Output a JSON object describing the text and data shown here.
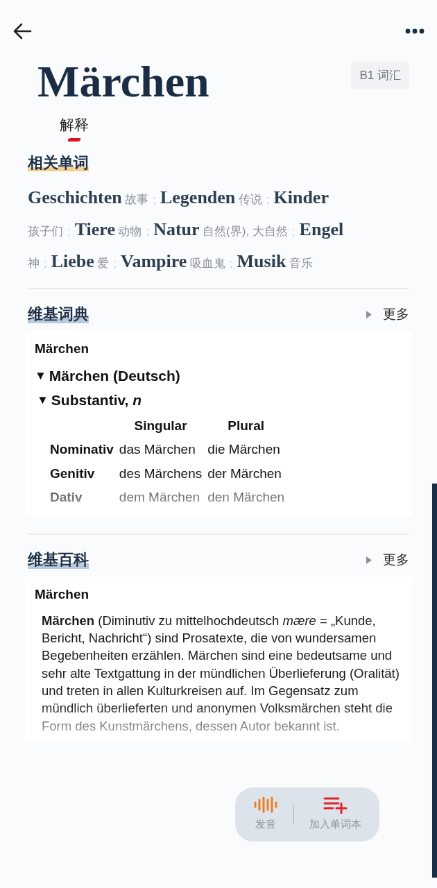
{
  "headword": {
    "text": "Märchen",
    "level_badge": "B1 词汇"
  },
  "tabs": [
    {
      "label": "解释",
      "selected": true
    }
  ],
  "related": {
    "title": "相关单词",
    "separator": ";",
    "items": [
      {
        "word": "Geschichten",
        "meaning": "故事"
      },
      {
        "word": "Legenden",
        "meaning": "传说"
      },
      {
        "word": "Kinder",
        "meaning": "孩子们"
      },
      {
        "word": "Tiere",
        "meaning": "动物"
      },
      {
        "word": "Natur",
        "meaning": "自然(界), 大自然"
      },
      {
        "word": "Engel",
        "meaning": "神"
      },
      {
        "word": "Liebe",
        "meaning": "爱"
      },
      {
        "word": "Vampire",
        "meaning": "吸血鬼"
      },
      {
        "word": "Musik",
        "meaning": "音乐"
      }
    ]
  },
  "wiktionary": {
    "title": "维基词典",
    "more": "更多",
    "heading": "Märchen",
    "sections": [
      {
        "toggle": "▼",
        "label": "Märchen (Deutsch)",
        "expanded": true,
        "children": [
          {
            "toggle": "▼",
            "label": "Substantiv, *n*",
            "expanded": true
          }
        ]
      }
    ],
    "table": {
      "columns": [
        "Singular",
        "Plural"
      ],
      "rows": [
        {
          "case": "Nominativ",
          "singular": "das Märchen",
          "plural": "die Märchen"
        },
        {
          "case": "Genitiv",
          "singular": "des Märchens",
          "plural": "der Märchen"
        },
        {
          "case": "Dativ",
          "singular": "dem Märchen",
          "plural": "den Märchen"
        }
      ]
    }
  },
  "wikipedia": {
    "title": "维基百科",
    "more": "更多",
    "heading": "Märchen",
    "text": "**Märchen** (Diminutiv zu mittelhochdeutsch *mære* = „Kunde, Bericht, Nachricht“) sind Prosatexte, die von wundersamen Begebenheiten erzählen. Märchen sind eine bedeutsame und sehr alte Textgattung in der mündlichen Überlieferung (Oralität) und treten in allen Kulturkreisen auf. Im Gegensatz zum mündlich überlieferten und anonymen Volksmärchen steht die Form des Kunstmärchens, dessen Autor bekannt ist."
  },
  "actions": [
    {
      "kind": "sound",
      "label": "发音"
    },
    {
      "kind": "add-list",
      "label": "加入单词本"
    }
  ]
}
